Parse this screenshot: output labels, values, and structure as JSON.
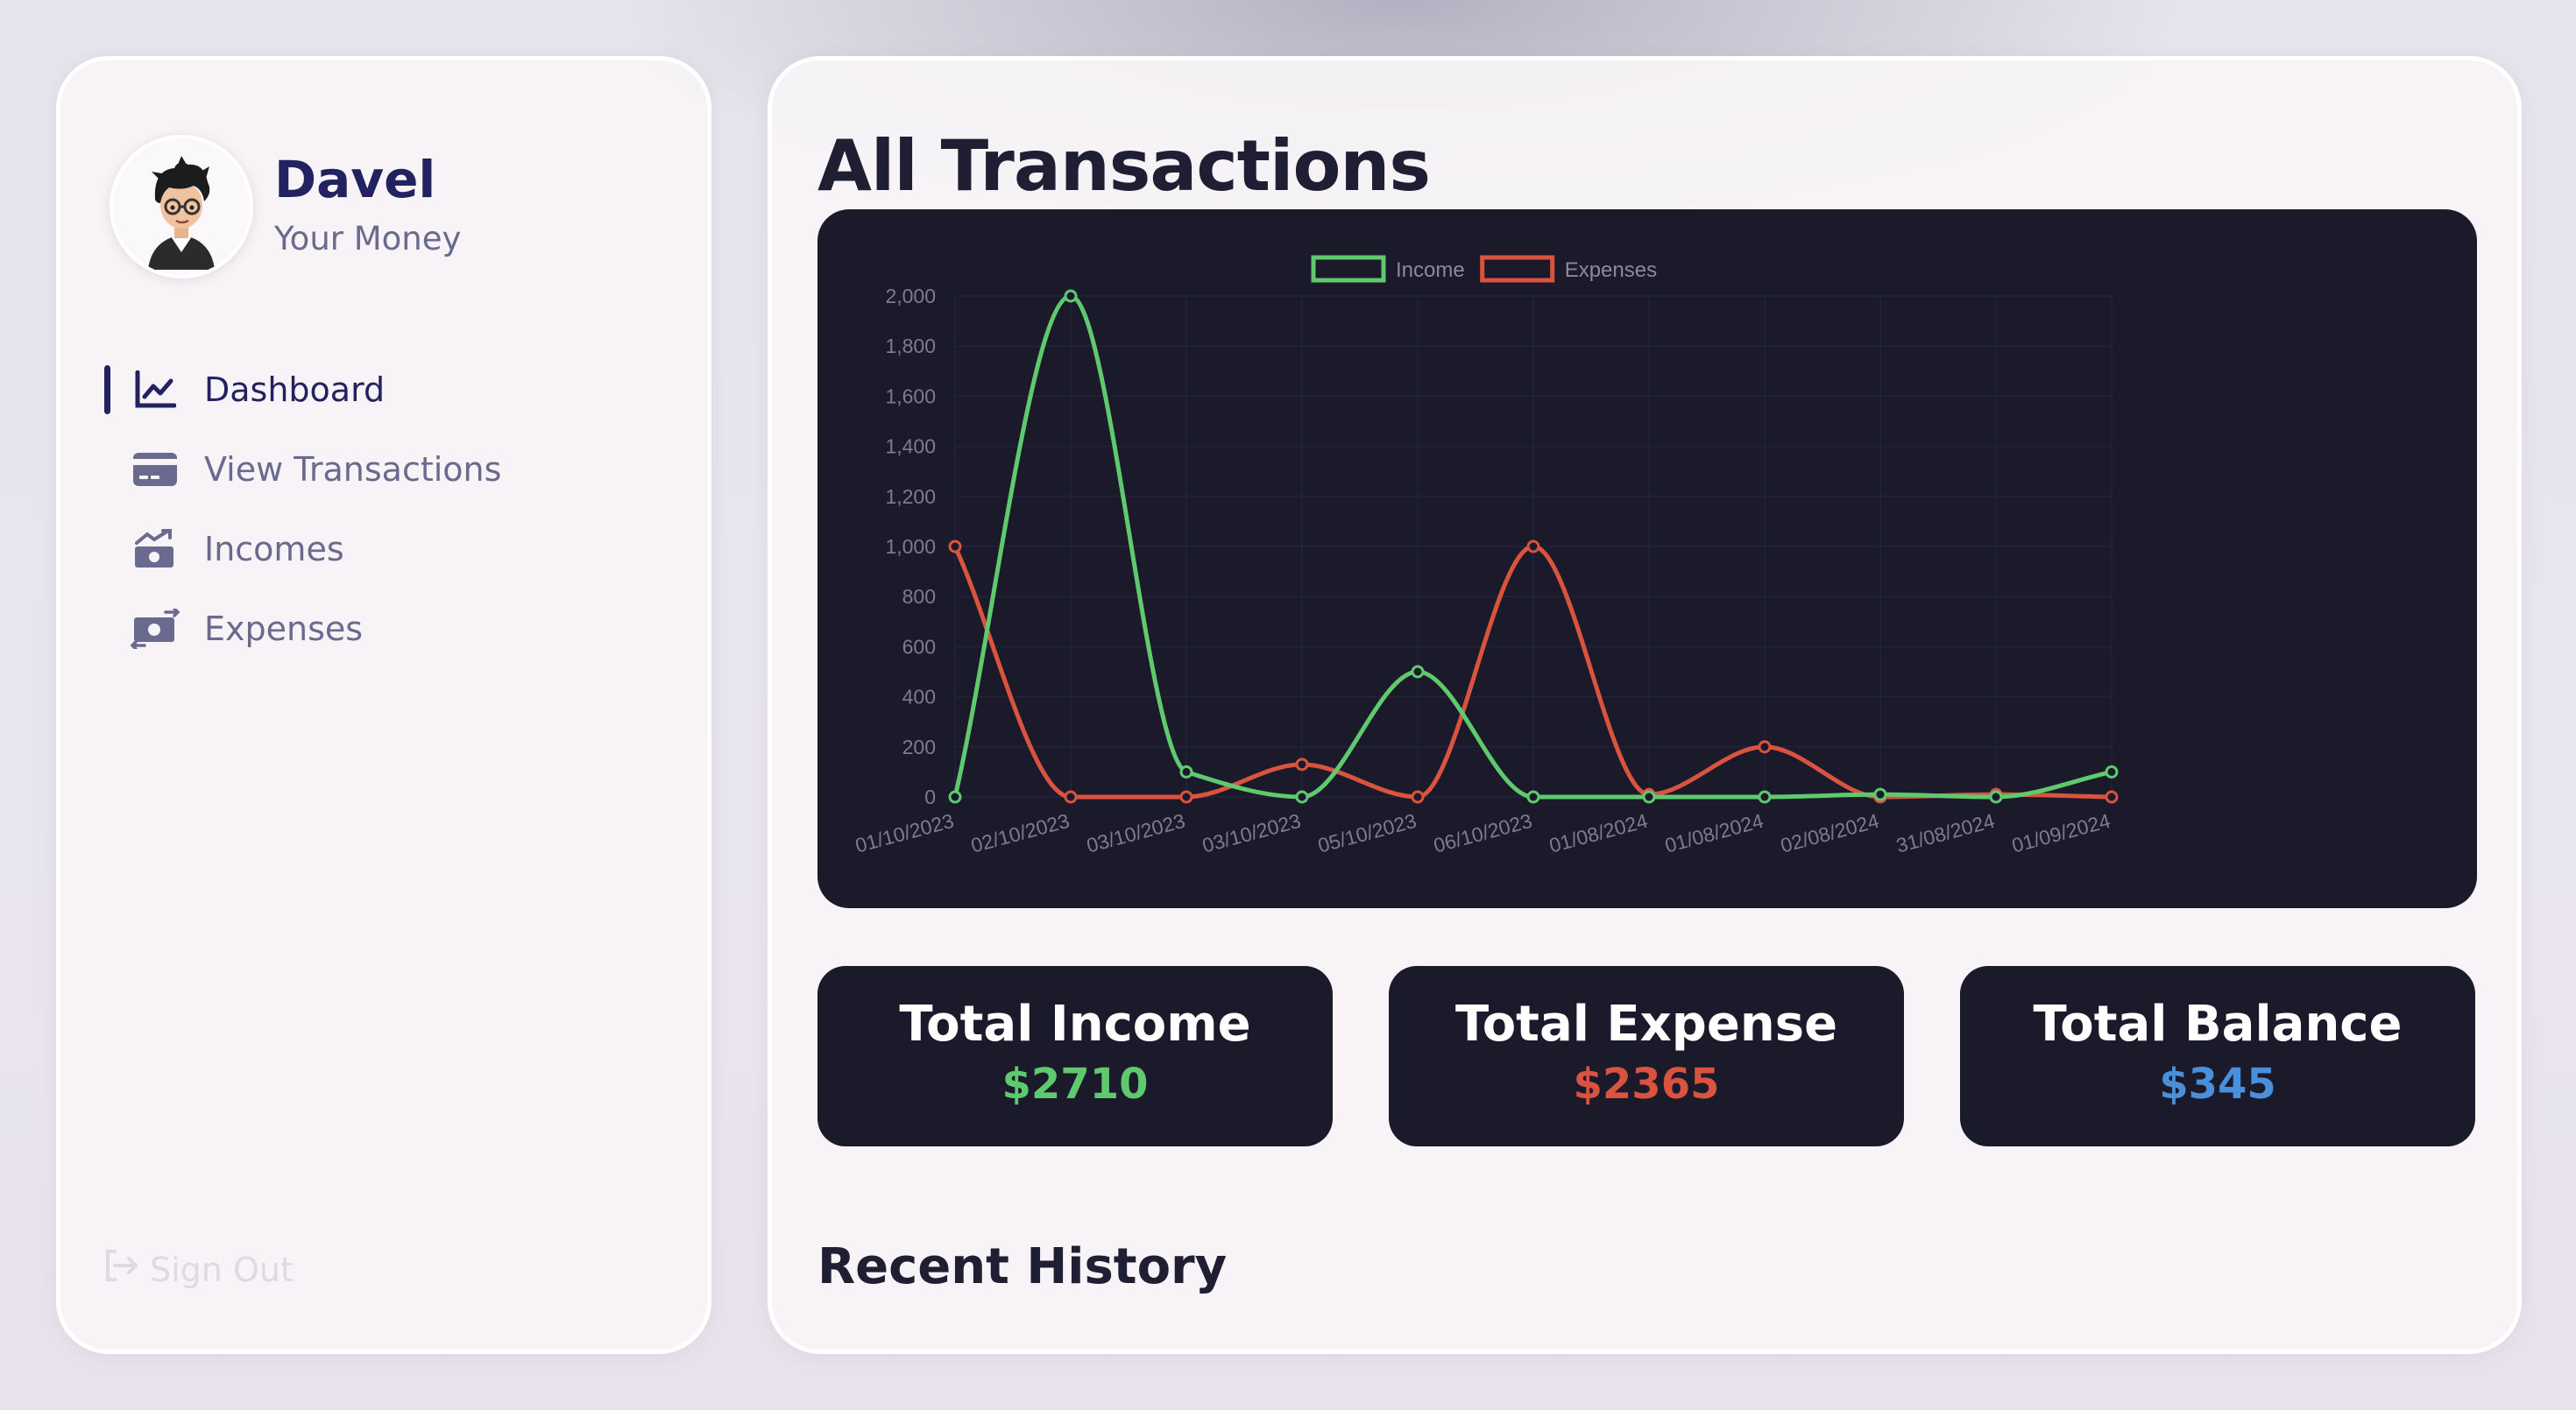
{
  "user": {
    "name": "Davel",
    "subtitle": "Your Money"
  },
  "nav": {
    "items": [
      {
        "label": "Dashboard",
        "icon": "chart-line-icon",
        "active": true
      },
      {
        "label": "View Transactions",
        "icon": "credit-card-icon",
        "active": false
      },
      {
        "label": "Incomes",
        "icon": "money-bill-trend-up-icon",
        "active": false
      },
      {
        "label": "Expenses",
        "icon": "money-bill-transfer-icon",
        "active": false
      }
    ],
    "signout": "Sign Out"
  },
  "main": {
    "title": "All Transactions",
    "recent_title": "Recent History"
  },
  "stats": {
    "income": {
      "label": "Total Income",
      "value": "$2710",
      "color": "#5fc96e"
    },
    "expense": {
      "label": "Total Expense",
      "value": "$2365",
      "color": "#d9533f"
    },
    "balance": {
      "label": "Total Balance",
      "value": "$345",
      "color": "#4a8fdc"
    }
  },
  "colors": {
    "primary": "#222260",
    "card_bg": "#1a1a2b",
    "income": "#5fc96e",
    "expense": "#d9533f"
  },
  "chart_data": {
    "type": "line",
    "categories": [
      "01/10/2023",
      "02/10/2023",
      "03/10/2023",
      "03/10/2023",
      "05/10/2023",
      "06/10/2023",
      "01/08/2024",
      "01/08/2024",
      "02/08/2024",
      "31/08/2024",
      "01/09/2024"
    ],
    "series": [
      {
        "name": "Income",
        "color": "#5fc96e",
        "values": [
          0,
          2000,
          100,
          0,
          500,
          0,
          0,
          0,
          10,
          0,
          100
        ]
      },
      {
        "name": "Expenses",
        "color": "#d9533f",
        "values": [
          1000,
          0,
          0,
          130,
          0,
          1000,
          10,
          200,
          0,
          10,
          0
        ]
      }
    ],
    "ylim": [
      0,
      2000
    ],
    "yticks": [
      "0",
      "200",
      "400",
      "600",
      "800",
      "1,000",
      "1,200",
      "1,400",
      "1,600",
      "1,800",
      "2,000"
    ],
    "grid": true,
    "legend": "top"
  }
}
